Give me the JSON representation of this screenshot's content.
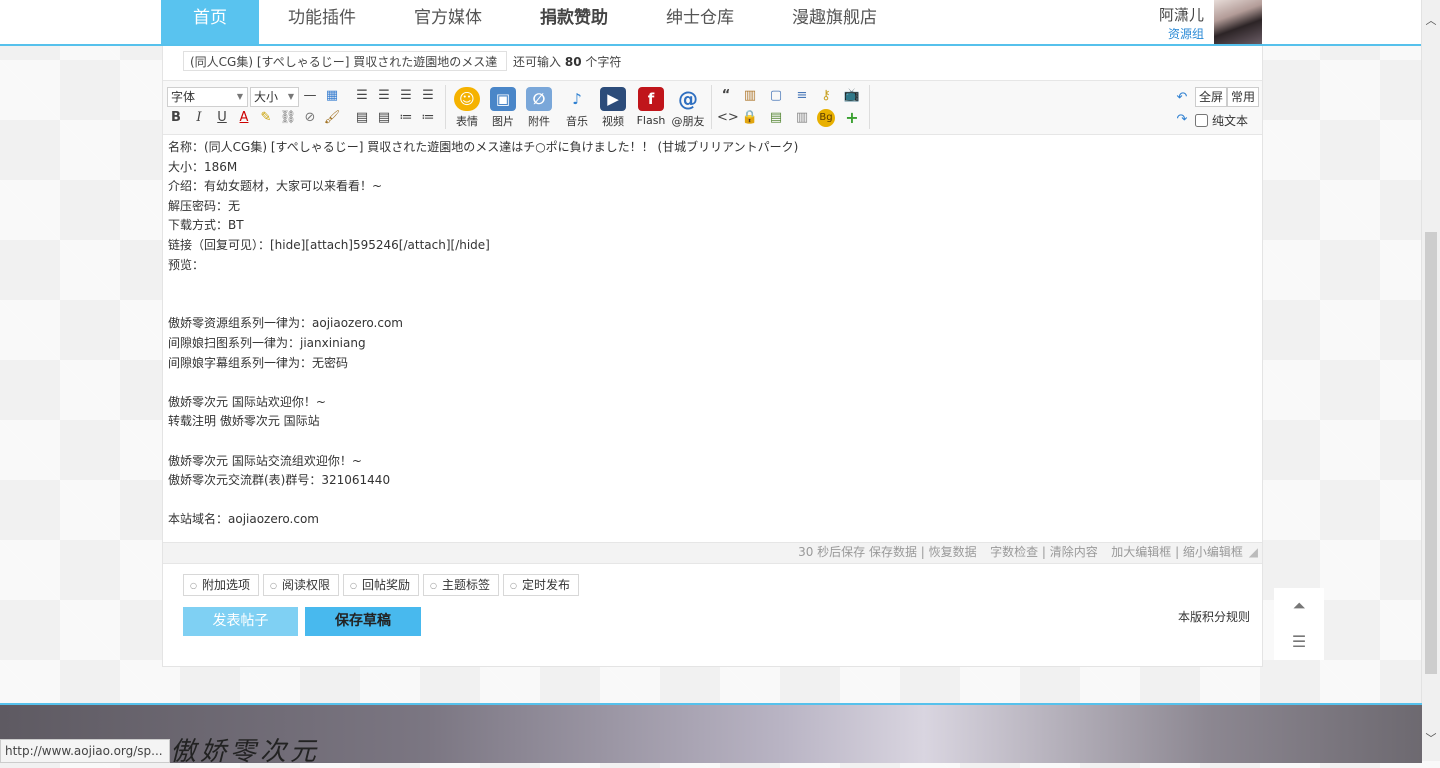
{
  "nav": {
    "items": [
      "首页",
      "功能插件",
      "官方媒体",
      "捐款赞助",
      "绅士仓库",
      "漫趣旗舰店"
    ],
    "user_name": "阿潇儿",
    "user_group": "资源组"
  },
  "subject": {
    "value": "(同人CG集) [すぺしゃるじー] 買収された遊園地のメス達",
    "remaining_prefix": "还可输入",
    "remaining_count": "80",
    "remaining_suffix": "个字符"
  },
  "toolbar": {
    "font_select": "字体",
    "size_select": "大小",
    "big_buttons": [
      "表情",
      "图片",
      "附件",
      "音乐",
      "视频",
      "Flash",
      "@朋友"
    ],
    "fullscreen": "全屏",
    "common": "常用",
    "plain_text": "纯文本"
  },
  "content_lines": [
    "名称：(同人CG集) [すぺしゃるじー] 買収された遊園地のメス達はチ○ポに負けました！！ (甘城ブリリアントパーク)",
    "大小：186M",
    "介绍：有幼女题材，大家可以来看看！~",
    "解压密码：无",
    "下载方式：BT",
    "链接（回复可见）：[hide][attach]595246[/attach][/hide]",
    "预览：",
    "",
    "",
    "傲娇零资源组系列一律为：aojiaozero.com",
    "间隙娘扫图系列一律为：jianxiniang",
    "间隙娘字幕组系列一律为：无密码",
    "",
    "傲娇零次元 国际站欢迎你！~",
    "转载注明 傲娇零次元 国际站",
    "",
    "傲娇零次元 国际站交流组欢迎你！~",
    "傲娇零次元交流群(表)群号：321061440",
    "",
    "本站域名：aojiaozero.com"
  ],
  "statusbar": {
    "autosave": "30 秒后保存 保存数据 | 恢复数据",
    "tools": "字数检查 | 清除内容",
    "resize": "加大编辑框 | 缩小编辑框"
  },
  "options": [
    "附加选项",
    "阅读权限",
    "回帖奖励",
    "主题标签",
    "定时发布"
  ],
  "actions": {
    "post": "发表帖子",
    "draft": "保存草稿",
    "rules": "本版积分规则"
  },
  "footer": {
    "logo_text": "傲娇零次元"
  },
  "status_url": "http://www.aojiao.org/sp...",
  "colors": {
    "accent": "#56c1ec",
    "post_button": "#7fd0f3",
    "draft_button": "#48b9ee",
    "link_blue": "#2b8ad6"
  }
}
